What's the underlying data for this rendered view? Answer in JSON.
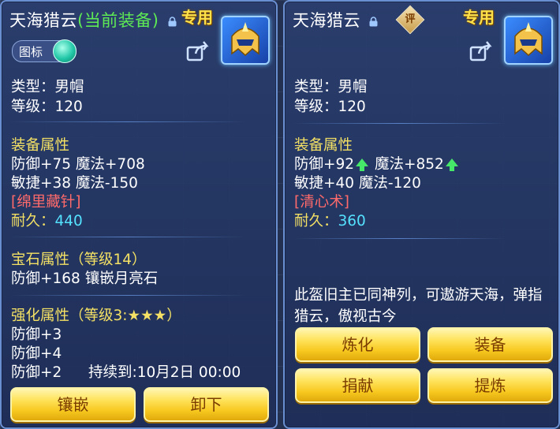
{
  "left": {
    "title": "天海猎云",
    "current_tag": "(当前装备)",
    "special": "专用",
    "icon_toggle": "图标",
    "type": "类型：男帽",
    "level": "等级：120",
    "equip_attr_header": "装备属性",
    "attr_line1": "防御+75 魔法+708",
    "attr_line2": "敏捷+38 魔法-150",
    "skill": "[绵里藏针]",
    "durability_label": "耐久：",
    "durability_value": "440",
    "gem_header": "宝石属性（等级14）",
    "gem_line": "防御+168 镶嵌月亮石",
    "enhance_header": "强化属性（等级3:★★★）",
    "enhance_lines": [
      "防御+3",
      "防御+4",
      "防御+2"
    ],
    "enhance_duration": "持续到:10月2日 00:00",
    "buttons": {
      "inlay": "镶嵌",
      "unequip": "卸下"
    }
  },
  "right": {
    "title": "天海猎云",
    "eval_badge": "评",
    "special": "专用",
    "type": "类型：男帽",
    "level": "等级：120",
    "equip_attr_header": "装备属性",
    "def": "防御+92",
    "magic": "魔法+852",
    "attr_line2": "敏捷+40 魔法-120",
    "skill": "[清心术]",
    "durability_label": "耐久：",
    "durability_value": "360",
    "description": "此盔旧主已同神列，可遨游天海，弹指猎云，傲视古今",
    "buttons": {
      "refine": "炼化",
      "equip": "装备",
      "donate": "捐献",
      "extract": "提炼"
    }
  },
  "colors": {
    "current_tag": "#5eea54",
    "header_yellow": "#f3e064",
    "skill_red": "#ff6a6a",
    "durability_cyan": "#55e2ff",
    "button_gold": "#f7c81f",
    "up_arrow": "#46e86a"
  }
}
